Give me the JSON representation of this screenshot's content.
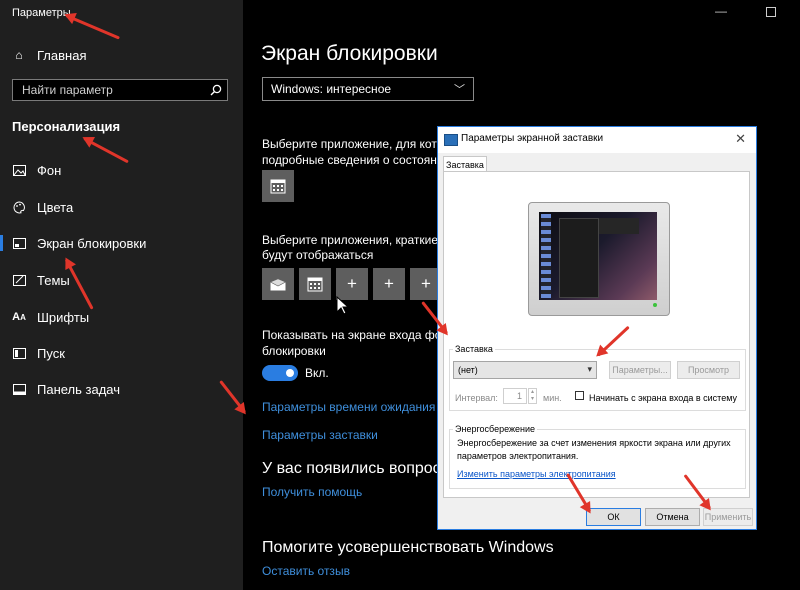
{
  "app_title": "Параметры",
  "sidebar": {
    "home_label": "Главная",
    "search_placeholder": "Найти параметр",
    "section_title": "Персонализация",
    "items": [
      {
        "label": "Фон",
        "icon": "image-icon"
      },
      {
        "label": "Цвета",
        "icon": "palette-icon"
      },
      {
        "label": "Экран блокировки",
        "icon": "lock-screen-icon",
        "selected": true
      },
      {
        "label": "Темы",
        "icon": "themes-icon"
      },
      {
        "label": "Шрифты",
        "icon": "fonts-icon"
      },
      {
        "label": "Пуск",
        "icon": "start-icon"
      },
      {
        "label": "Панель задач",
        "icon": "taskbar-icon"
      }
    ]
  },
  "main": {
    "title": "Экран блокировки",
    "background_select": "Windows: интересное",
    "detailed_app_text_1": "Выберите приложение, для котор",
    "detailed_app_text_2": "подробные сведения о состояни",
    "quick_apps_text_1": "Выберите приложения, краткие с",
    "quick_apps_text_2": "будут отображаться",
    "plus": "+",
    "show_bg_text_1": "Показывать на экране входа фон",
    "show_bg_text_2": "блокировки",
    "toggle_label": "Вкл.",
    "link_timeout": "Параметры времени ожидания д",
    "link_screensaver": "Параметры заставки",
    "questions_heading": "У вас появились вопросы",
    "help_link": "Получить помощь",
    "improve_heading": "Помогите усовершенствовать Windows",
    "feedback_link": "Оставить отзыв"
  },
  "dialog": {
    "title": "Параметры экранной заставки",
    "close": "✕",
    "tab": "Заставка",
    "screensaver_group": "Заставка",
    "screensaver_value": "(нет)",
    "params_button": "Параметры...",
    "preview_button": "Просмотр",
    "interval_label": "Интервал:",
    "interval_value": "1",
    "minutes_label": "мин.",
    "logon_checkbox": "Начинать с экрана входа в систему",
    "power_group": "Энергосбережение",
    "power_text_1": "Энергосбережение за счет изменения яркости экрана или других",
    "power_text_2": "параметров электропитания.",
    "power_link": "Изменить параметры электропитания",
    "ok": "ОК",
    "cancel": "Отмена",
    "apply": "Применить"
  },
  "colors": {
    "accent": "#2a7de1",
    "link": "#3f8fdc",
    "arrow": "#e0352a",
    "sidebar_bg": "#1f1f1f"
  }
}
